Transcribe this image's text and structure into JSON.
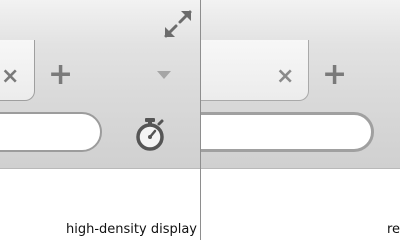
{
  "left_panel": {
    "caption": "high-density display",
    "tab_close": "×",
    "new_tab": "+"
  },
  "right_panel": {
    "caption": "re",
    "tab_close": "×",
    "new_tab": "+"
  },
  "colors": {
    "toolbar_bg": "#d9d9d9",
    "icon_gray": "#7a7a7a",
    "divider": "#8e8e8e"
  },
  "icons": [
    "close-icon",
    "plus-icon",
    "chevron-down-icon",
    "resize-arrows-icon",
    "stopwatch-icon"
  ]
}
